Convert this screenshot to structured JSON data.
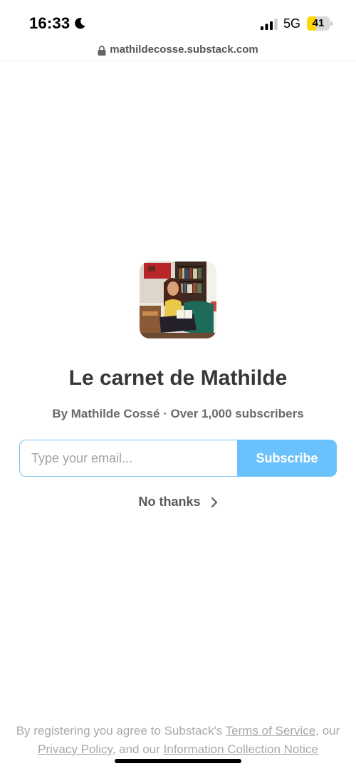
{
  "status_bar": {
    "time": "16:33",
    "network": "5G",
    "battery_level": "41",
    "icons": [
      "moon-icon",
      "signal-icon",
      "battery-icon"
    ]
  },
  "url_bar": {
    "domain": "mathildecosse.substack.com",
    "icon": "lock-icon"
  },
  "publication": {
    "title": "Le carnet de Mathilde",
    "byline": "By Mathilde Cossé · Over 1,000 subscribers",
    "avatar": "author-photo-reading"
  },
  "signup": {
    "email_placeholder": "Type your email...",
    "subscribe_label": "Subscribe",
    "no_thanks_label": "No thanks"
  },
  "legal": {
    "prefix": "By registering you agree to Substack's ",
    "terms_link": "Terms of Service",
    "sep1": ", our ",
    "privacy_link": "Privacy Policy",
    "sep2": ", and our ",
    "notice_link": "Information Collection Notice"
  },
  "colors": {
    "accent": "#6bc1fb",
    "input_border": "#7cc3f2",
    "battery_fill": "#ffd60a",
    "title_text": "#363737",
    "muted_text": "#a8a8a8"
  }
}
